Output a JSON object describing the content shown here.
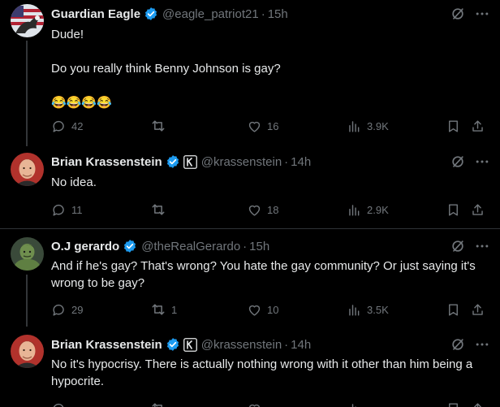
{
  "tweets": [
    {
      "name": "Guardian Eagle",
      "handle": "@eagle_patriot21",
      "time": "15h",
      "text": "Dude!\n\nDo you really think Benny Johnson is gay?\n\n😂😂😂😂",
      "replies": "42",
      "reposts": "",
      "likes": "16",
      "views": "3.9K",
      "avatar": "eagle-flag-avatar"
    },
    {
      "name": "Brian Krassenstein",
      "handle": "@krassenstein",
      "time": "14h",
      "text": "No idea.",
      "replies": "11",
      "reposts": "",
      "likes": "18",
      "views": "2.9K",
      "avatar": "man-avatar"
    },
    {
      "name": "O.J gerardo",
      "handle": "@theRealGerardo",
      "time": "15h",
      "text": "And if he's gay? That's wrong? You hate the gay community? Or just saying it's wrong to be gay?",
      "replies": "29",
      "reposts": "1",
      "likes": "10",
      "views": "3.5K",
      "avatar": "hulk-avatar"
    },
    {
      "name": "Brian Krassenstein",
      "handle": "@krassenstein",
      "time": "14h",
      "text": "No it's hypocrisy. There is actually nothing wrong with it other than him being a hypocrite.",
      "replies": "",
      "reposts": "",
      "likes": "",
      "views": "",
      "avatar": "man-avatar"
    }
  ],
  "separator": "·",
  "colors": {
    "background": "#000000",
    "text": "#e7e9ea",
    "muted": "#71767b",
    "verified": "#1d9bf0",
    "divider": "#2f3336"
  }
}
